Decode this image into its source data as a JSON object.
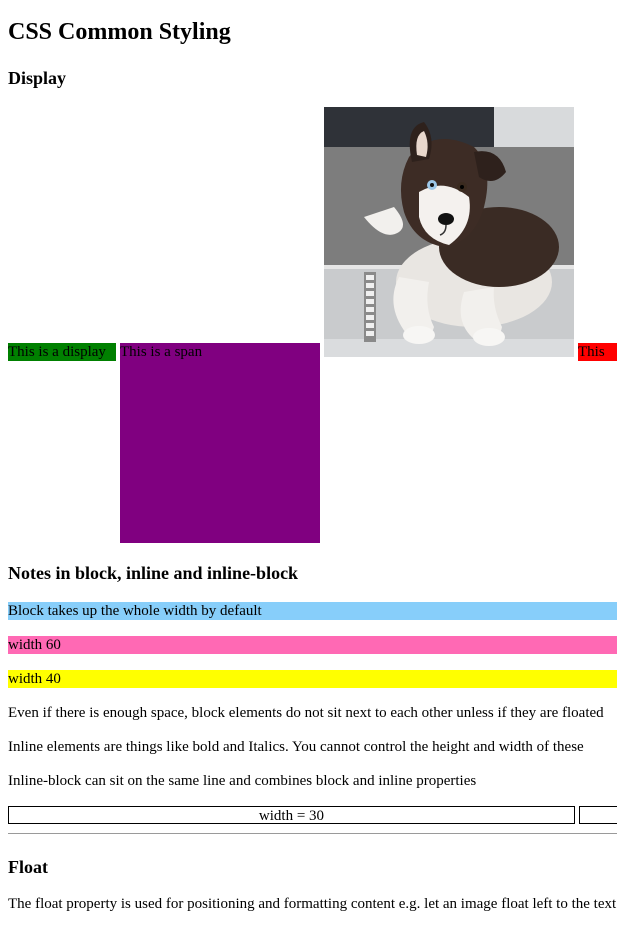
{
  "page": {
    "title": "CSS Common Styling"
  },
  "display_section": {
    "heading": "Display",
    "green_box_text": "This is a display",
    "span_box_text": "This is a span",
    "red_box_text": "This is",
    "image_alt": "husky puppy photo"
  },
  "notes_section": {
    "heading": "Notes in block, inline and inline-block",
    "block_full": "Block takes up the whole width by default",
    "width60": "width 60",
    "width40": "width 40",
    "p1": "Even if there is enough space, block elements do not sit next to each other unless if they are floated",
    "p2": "Inline elements are things like bold and Italics. You cannot control the height and width of these",
    "p3": "Inline-block can sit on the same line and combines block and inline properties",
    "width30_label": "width = 30"
  },
  "float_section": {
    "heading": "Float",
    "p1": "The float property is used for positioning and formatting content e.g. let an image float left to the text"
  },
  "colors": {
    "green": "#008000",
    "purple": "#800080",
    "red": "#ff0000",
    "light_blue": "#87cefa",
    "pink": "#ff69b4",
    "yellow": "#ffff00"
  }
}
